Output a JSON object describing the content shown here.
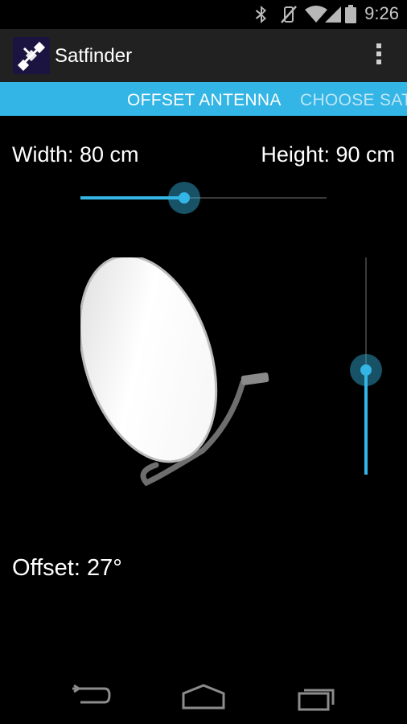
{
  "status_bar": {
    "time": "9:26",
    "icons": [
      "bluetooth-icon",
      "vibrate-mute-icon",
      "wifi-icon",
      "signal-icon",
      "battery-icon"
    ]
  },
  "action_bar": {
    "title": "Satfinder",
    "app_icon": "satellite-icon",
    "overflow_icon": "overflow-menu-icon"
  },
  "tabs": [
    {
      "label": "OFFSET ANTENNA",
      "selected": true
    },
    {
      "label": "CHOOSE SAT",
      "selected": false
    }
  ],
  "antenna": {
    "width_label": "Width: 80 cm",
    "height_label": "Height: 90 cm",
    "offset_label": "Offset: 27°",
    "width_slider_fraction": 0.42,
    "height_slider_fraction": 0.5
  },
  "nav_bar": {
    "icons": [
      "back-icon",
      "home-icon",
      "recent-apps-icon"
    ]
  },
  "colors": {
    "accent": "#33b5e5",
    "action_bar": "#212121",
    "background": "#000000"
  }
}
